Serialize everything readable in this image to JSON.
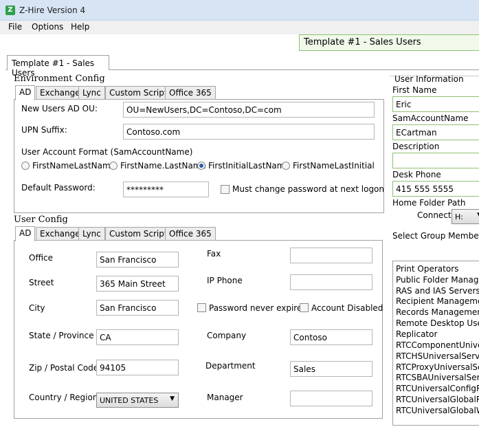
{
  "window": {
    "title": "Z-Hire Version 4",
    "icon": "z-hire-logo-icon"
  },
  "menu": [
    "File",
    "Options",
    "Help"
  ],
  "template_banner": "Template #1 - Sales Users",
  "main_tab": "Template #1 - Sales Users",
  "env_config": {
    "title": "Environment Config",
    "tabs": [
      "AD",
      "Exchange",
      "Lync",
      "Custom Script",
      "Office 365"
    ],
    "active_tab": "AD",
    "new_users_ou_label": "New Users AD OU:",
    "new_users_ou_value": "OU=NewUsers,DC=Contoso,DC=com",
    "upn_suffix_label": "UPN Suffix:",
    "upn_suffix_value": "Contoso.com",
    "account_format_label": "User Account Format (SamAccountName)",
    "formats": [
      "FirstNameLastName",
      "FirstName.LastName",
      "FirstInitialLastName",
      "FirstNameLastInitial"
    ],
    "selected_format": "FirstInitialLastName",
    "default_password_label": "Default Password:",
    "default_password_value": "*********",
    "must_change_label": "Must change password at next logon",
    "must_change_checked": false
  },
  "user_config": {
    "title": "User Config",
    "tabs": [
      "AD",
      "Exchange",
      "Lync",
      "Custom Script",
      "Office 365"
    ],
    "active_tab": "AD",
    "office_label": "Office",
    "office_value": "San Francisco",
    "street_label": "Street",
    "street_value": "365 Main Street",
    "city_label": "City",
    "city_value": "San Francisco",
    "state_label": "State / Province",
    "state_value": "CA",
    "zip_label": "Zip / Postal Code",
    "zip_value": "94105",
    "country_label": "Country / Region",
    "country_value": "UNITED STATES",
    "fax_label": "Fax",
    "fax_value": "",
    "ip_phone_label": "IP Phone",
    "ip_phone_value": "",
    "pwd_never_expires_label": "Password never expires",
    "account_disabled_label": "Account Disabled",
    "company_label": "Company",
    "company_value": "Contoso",
    "department_label": "Department",
    "department_value": "Sales",
    "manager_label": "Manager",
    "manager_value": ""
  },
  "user_info": {
    "title": "User Information",
    "first_name_label": "First Name",
    "first_name_value": "Eric",
    "sam_label": "SamAccountName",
    "sam_value": "ECartman",
    "description_label": "Description",
    "description_value": "",
    "desk_phone_label": "Desk Phone",
    "desk_phone_value": "415 555 5555",
    "home_folder_label": "Home Folder Path",
    "connect_label": "Connect",
    "connect_value": "H:",
    "groups_label": "Select Group Membersh",
    "groups": [
      "Print Operators",
      "Public Folder Managem",
      "RAS and IAS Servers",
      "Recipient Management",
      "Records Management",
      "Remote Desktop Users",
      "Replicator",
      "RTCComponentUnivers",
      "RTCHSUniversalService",
      "RTCProxyUniversalServ",
      "RTCSBAUniversalService",
      "RTCUniversalConfigRep",
      "RTCUniversalGlobalRea",
      "RTCUniversalGlobalWri"
    ]
  }
}
